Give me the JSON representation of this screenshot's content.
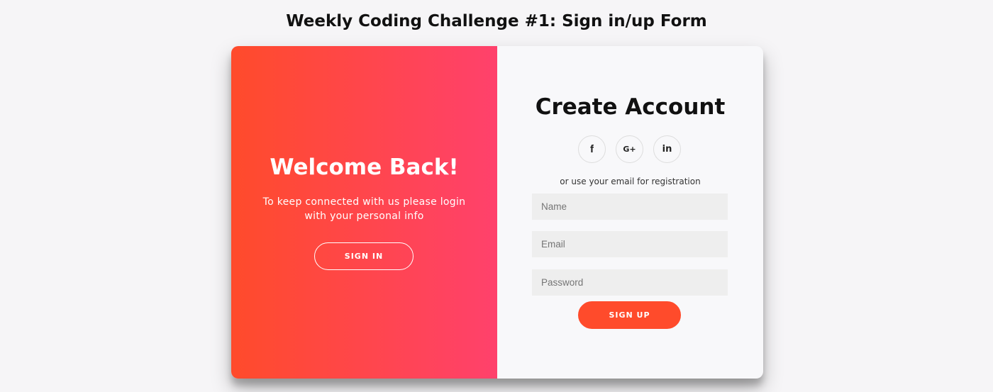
{
  "header": {
    "title": "Weekly Coding Challenge #1: Sign in/up Form"
  },
  "overlay": {
    "title": "Welcome Back!",
    "text": "To keep connected with us please login with your personal info",
    "signin_label": "Sign In"
  },
  "signup": {
    "title": "Create Account",
    "social": [
      {
        "icon": "facebook-icon",
        "glyph": "f"
      },
      {
        "icon": "google-plus-icon",
        "glyph": "G+"
      },
      {
        "icon": "linkedin-icon",
        "glyph": "in"
      }
    ],
    "hint": "or use your email for registration",
    "fields": {
      "name": {
        "placeholder": "Name",
        "value": ""
      },
      "email": {
        "placeholder": "Email",
        "value": ""
      },
      "password": {
        "placeholder": "Password",
        "value": ""
      }
    },
    "signup_label": "Sign Up"
  },
  "colors": {
    "accent": "#ff4b2b",
    "gradient_end": "#ff416c",
    "background": "#f6f5f7",
    "input_bg": "#eeeeee"
  }
}
